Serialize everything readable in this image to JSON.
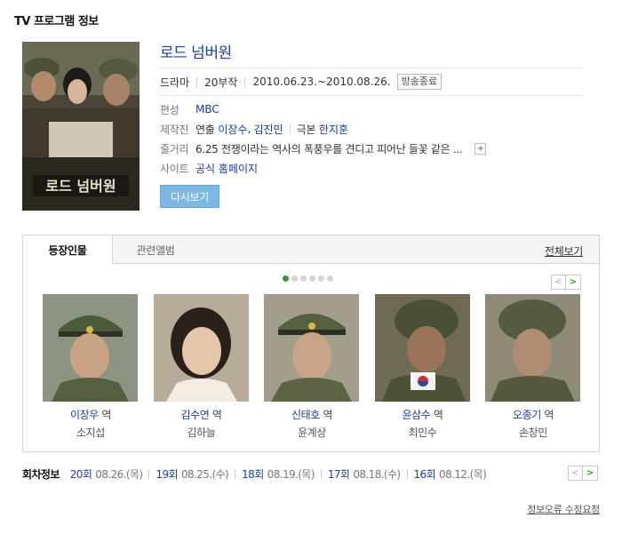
{
  "section_title": "TV 프로그램 정보",
  "program": {
    "title": "로드 넘버원",
    "genre": "드라마",
    "episodes_count": "20부작",
    "air_period": "2010.06.23.~2010.08.26.",
    "status_badge": "방송종료",
    "poster_text": "로드 넘버원"
  },
  "info": {
    "broadcaster_label": "편성",
    "broadcaster": "MBC",
    "staff_label": "제작진",
    "director_label": "연출",
    "directors": [
      "이장수",
      "김진민"
    ],
    "writer_label": "극본",
    "writer": "한지훈",
    "synopsis_label": "줄거리",
    "synopsis": "6.25 전쟁이라는 역사의 폭풍우를 견디고 피어난 들꽃 같은 ...",
    "expand_symbol": "+",
    "site_label": "사이트",
    "site_link": "공식 홈페이지"
  },
  "rewatch_button": "다시보기",
  "tabs": {
    "cast": "등장인물",
    "album": "관련앨범",
    "view_all": "전체보기"
  },
  "cast_pager": {
    "prev": "<",
    "next": ">"
  },
  "cast_page_dots": 6,
  "cast_active_dot": 0,
  "cast": [
    {
      "role": "이장우",
      "role_suffix": "역",
      "actor": "소지섭"
    },
    {
      "role": "김수연",
      "role_suffix": "역",
      "actor": "김하늘"
    },
    {
      "role": "신태호",
      "role_suffix": "역",
      "actor": "윤계상"
    },
    {
      "role": "윤삼수",
      "role_suffix": "역",
      "actor": "최민수"
    },
    {
      "role": "오종기",
      "role_suffix": "역",
      "actor": "손창민"
    }
  ],
  "episode_info": {
    "label": "회차정보",
    "items": [
      {
        "num": "20회",
        "date": "08.26.(목)"
      },
      {
        "num": "19회",
        "date": "08.25.(수)"
      },
      {
        "num": "18회",
        "date": "08.19.(목)"
      },
      {
        "num": "17회",
        "date": "08.18.(수)"
      },
      {
        "num": "16회",
        "date": "08.12.(목)"
      }
    ],
    "prev": "<",
    "next": ">"
  },
  "report_link": "정보오류 수정요청",
  "colors": {
    "link_blue": "#1a3ea3",
    "button_blue": "#7db7e4",
    "active_green": "#2e9e2e"
  }
}
